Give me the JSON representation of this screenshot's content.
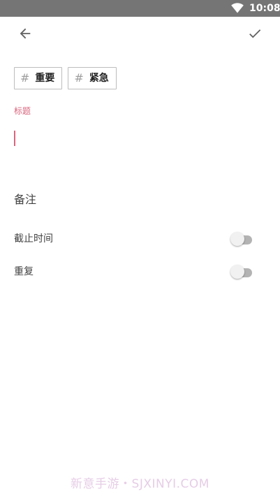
{
  "status_bar": {
    "time": "10:08",
    "wifi_icon": "wifi-icon"
  },
  "toolbar": {
    "back_icon": "arrow-left-icon",
    "done_icon": "checkmark-icon"
  },
  "tags": [
    {
      "hash": "#",
      "label": "重要"
    },
    {
      "hash": "#",
      "label": "紧急"
    }
  ],
  "title_field": {
    "label": "标题",
    "value": "",
    "accent_color": "#d9667d"
  },
  "note": {
    "label": "备注"
  },
  "settings": {
    "deadline": {
      "label": "截止时间",
      "enabled": false
    },
    "repeat": {
      "label": "重复",
      "enabled": false
    }
  },
  "watermark": "新意手游・SJXINYI.COM"
}
